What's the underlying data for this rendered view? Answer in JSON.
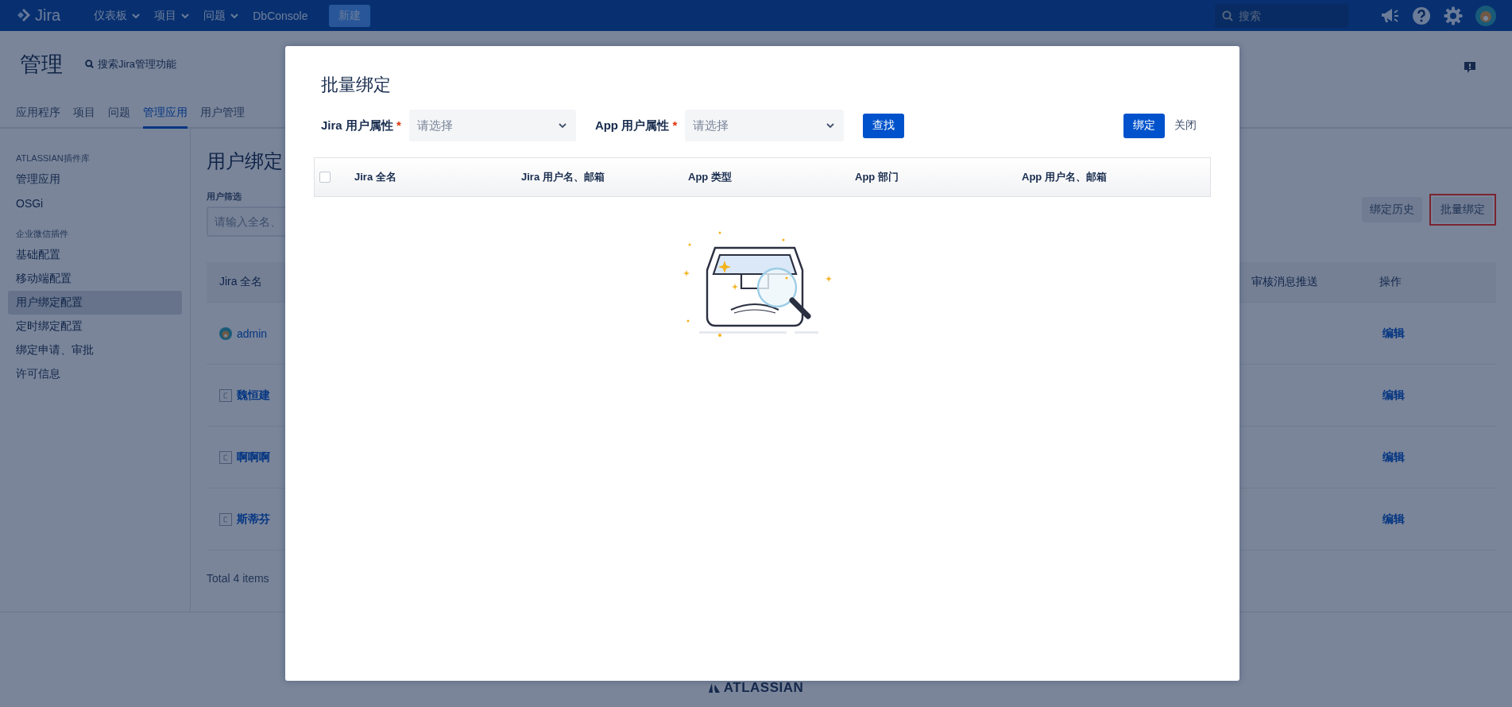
{
  "top_nav": {
    "logo": "Jira",
    "menus": [
      {
        "label": "仪表板",
        "dropdown": true
      },
      {
        "label": "项目",
        "dropdown": true
      },
      {
        "label": "问题",
        "dropdown": true
      },
      {
        "label": "DbConsole",
        "dropdown": false
      }
    ],
    "create_button": "新建",
    "search": {
      "placeholder": "搜索"
    }
  },
  "page_header": {
    "title": "管理",
    "search_link": "搜索Jira管理功能"
  },
  "tabs": [
    {
      "label": "应用程序",
      "selected": false
    },
    {
      "label": "项目",
      "selected": false
    },
    {
      "label": "问题",
      "selected": false
    },
    {
      "label": "管理应用",
      "selected": true
    },
    {
      "label": "用户管理",
      "selected": false
    }
  ],
  "sidebar": {
    "sections": [
      {
        "heading": "ATLASSIAN插件库",
        "items": [
          {
            "label": "管理应用",
            "selected": false
          },
          {
            "label": "OSGi",
            "selected": false
          }
        ]
      },
      {
        "heading": "企业微信插件",
        "items": [
          {
            "label": "基础配置",
            "selected": false
          },
          {
            "label": "移动端配置",
            "selected": false
          },
          {
            "label": "用户绑定配置",
            "selected": true
          },
          {
            "label": "定时绑定配置",
            "selected": false
          },
          {
            "label": "绑定申请、审批",
            "selected": false
          },
          {
            "label": "许可信息",
            "selected": false
          }
        ]
      }
    ]
  },
  "content": {
    "title": "用户绑定",
    "filter": {
      "label": "用户筛选",
      "placeholder": "请输入全名、"
    },
    "buttons": [
      {
        "label": "绑定历史",
        "highlighted": false
      },
      {
        "label": "批量绑定",
        "highlighted": true
      }
    ],
    "table": {
      "columns": [
        "Jira 全名",
        "审核消息推送",
        "操作"
      ],
      "rows": [
        {
          "name": "admin",
          "kind": "photo",
          "action": "编辑"
        },
        {
          "name": "魏恒建",
          "kind": "default",
          "action": "编辑"
        },
        {
          "name": "啊啊啊",
          "kind": "default",
          "action": "编辑"
        },
        {
          "name": "斯蒂芬",
          "kind": "default",
          "action": "编辑"
        }
      ]
    },
    "total": "Total 4 items"
  },
  "modal": {
    "title": "批量绑定",
    "filters": [
      {
        "label": "Jira 用户属性",
        "required_mark": "*",
        "placeholder": "请选择"
      },
      {
        "label": "App 用户属性",
        "required_mark": "*",
        "placeholder": "请选择"
      }
    ],
    "search_button": "查找",
    "bind_button": "绑定",
    "close_button": "关闭",
    "table": {
      "select_all_checked": false,
      "columns": [
        "Jira 全名",
        "Jira 用户名、邮箱",
        "App 类型",
        "App 部门",
        "App 用户名、邮箱"
      ]
    }
  },
  "footer": {
    "logo": "ATLASSIAN"
  }
}
